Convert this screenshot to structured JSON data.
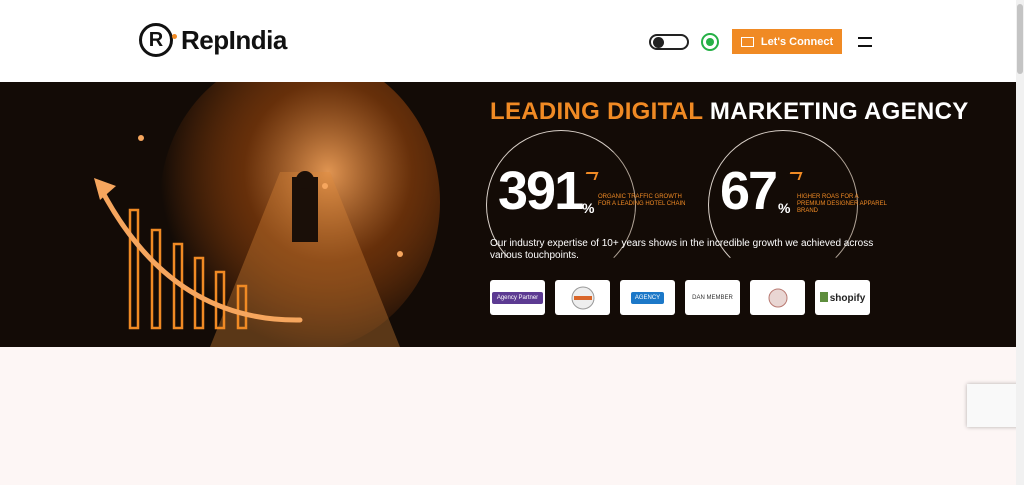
{
  "header": {
    "brand": "RepIndia",
    "cta_label": "Let's Connect",
    "icons": [
      "theme-toggle-icon",
      "whatsapp-icon",
      "mail-icon",
      "menu-icon"
    ]
  },
  "hero": {
    "headline_orange": "LEADING DIGITAL",
    "headline_white": "MARKETING AGENCY",
    "stats": [
      {
        "value": "391",
        "unit": "%",
        "label": "ORGANIC TRAFFIC GROWTH FOR A LEADING HOTEL CHAIN"
      },
      {
        "value": "67",
        "unit": "%",
        "label": "HIGHER ROAS FOR A PREMIUM DESIGNER APPAREL BRAND"
      }
    ],
    "description": "Our industry expertise of 10+ years shows in the incredible growth we achieved across various touchpoints.",
    "badges": [
      "Agency Partner",
      "",
      "AGENCY",
      "DAN MEMBER",
      "",
      "shopify"
    ]
  },
  "colors": {
    "accent": "#f08a24",
    "hero_bg": "#130b06",
    "page_bg": "#fdf6f5"
  }
}
